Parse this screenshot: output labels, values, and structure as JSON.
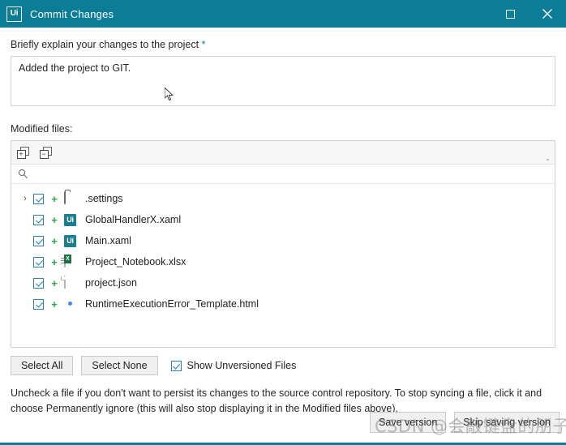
{
  "window": {
    "logo": "Ui",
    "title": "Commit Changes",
    "maximize_icon": "maximize-icon",
    "close_icon": "close-icon",
    "accent_color": "#0b7d96"
  },
  "message": {
    "label": "Briefly explain your changes to the project",
    "required_marker": "*",
    "value": "Added the project to GIT.",
    "placeholder": ""
  },
  "modified": {
    "label": "Modified files:",
    "toolbar": {
      "expand_all": "+",
      "collapse_all": "−",
      "overflow": "⌄"
    },
    "search": {
      "value": "",
      "placeholder": ""
    },
    "files": [
      {
        "name": ".settings",
        "icon": "folder-icon",
        "status": "+",
        "checked": true,
        "expandable": true,
        "chevron": "›"
      },
      {
        "name": "GlobalHandlerX.xaml",
        "icon": "uipath-xaml-icon",
        "status": "+",
        "checked": true,
        "expandable": false,
        "chevron": ""
      },
      {
        "name": "Main.xaml",
        "icon": "uipath-xaml-icon",
        "status": "+",
        "checked": true,
        "expandable": false,
        "chevron": ""
      },
      {
        "name": "Project_Notebook.xlsx",
        "icon": "excel-icon",
        "status": "+",
        "checked": true,
        "expandable": false,
        "chevron": ""
      },
      {
        "name": "project.json",
        "icon": "document-icon",
        "status": "+",
        "checked": true,
        "expandable": false,
        "chevron": ""
      },
      {
        "name": "RuntimeExecutionError_Template.html",
        "icon": "chrome-icon",
        "status": "+",
        "checked": true,
        "expandable": false,
        "chevron": ""
      }
    ]
  },
  "controls": {
    "select_all": "Select All",
    "select_none": "Select None",
    "show_unversioned": {
      "label": "Show Unversioned Files",
      "checked": true
    }
  },
  "hint": "Uncheck a file if you don't want to persist its changes to the source control repository. To stop syncing a file, click it and choose Permanently ignore (this will also stop displaying it in the Modified files above).",
  "footer": {
    "save": "Save version",
    "skip": "Skip saving version"
  },
  "watermark": "CSDN @会敲键盘的朋子"
}
